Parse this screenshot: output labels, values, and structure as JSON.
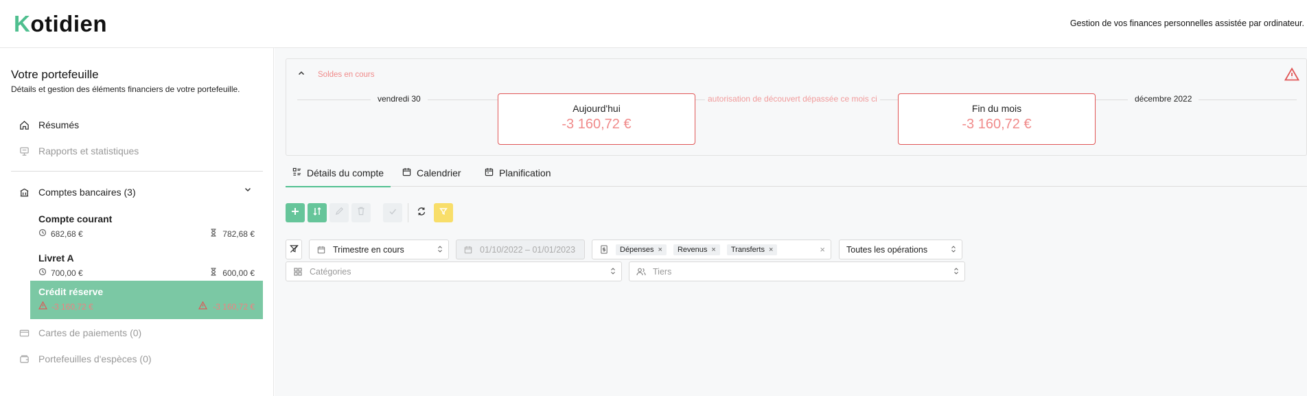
{
  "header": {
    "logo_first": "K",
    "logo_rest": "otidien",
    "tagline": "Gestion de vos finances personnelles assistée par ordinateur."
  },
  "sidebar": {
    "title": "Votre portefeuille",
    "subtitle": "Détails et gestion des éléments financiers de votre portefeuille.",
    "nav": [
      {
        "label": "Résumés"
      },
      {
        "label": "Rapports et statistiques"
      }
    ],
    "bank_accounts_label": "Comptes bancaires (3)",
    "accounts": [
      {
        "name": "Compte courant",
        "current": "682,68 €",
        "forecast": "782,68 €"
      },
      {
        "name": "Livret A",
        "current": "700,00 €",
        "forecast": "600,00 €"
      },
      {
        "name": "Crédit réserve",
        "current": "-3 160,72 €",
        "forecast": "-3 160,72 €"
      }
    ],
    "cards_label": "Cartes de paiements (0)",
    "cash_label": "Portefeuilles d'espèces (0)"
  },
  "soldes": {
    "title": "Soldes en cours",
    "start_label": "vendredi 30",
    "today_label": "Aujourd'hui",
    "today_value": "-3 160,72 €",
    "overdraft_text": "autorisation de découvert dépassée ce mois ci",
    "end_label": "Fin du mois",
    "end_value": "-3 160,72 €",
    "month_label": "décembre 2022"
  },
  "tabs": [
    {
      "label": "Détails du compte"
    },
    {
      "label": "Calendrier"
    },
    {
      "label": "Planification"
    }
  ],
  "filters": {
    "period": "Trimestre en cours",
    "date_range": "01/10/2022 – 01/01/2023",
    "chips": [
      "Dépenses",
      "Revenus",
      "Transferts"
    ],
    "operations": "Toutes les opérations",
    "categories_placeholder": "Catégories",
    "tiers_placeholder": "Tiers"
  },
  "colors": {
    "accent_green": "#66c59a",
    "active_account_bg": "#7bc8a4",
    "negative_red": "#f08a8a",
    "warning_red": "#e05555",
    "filter_yellow": "#f8de6a"
  }
}
